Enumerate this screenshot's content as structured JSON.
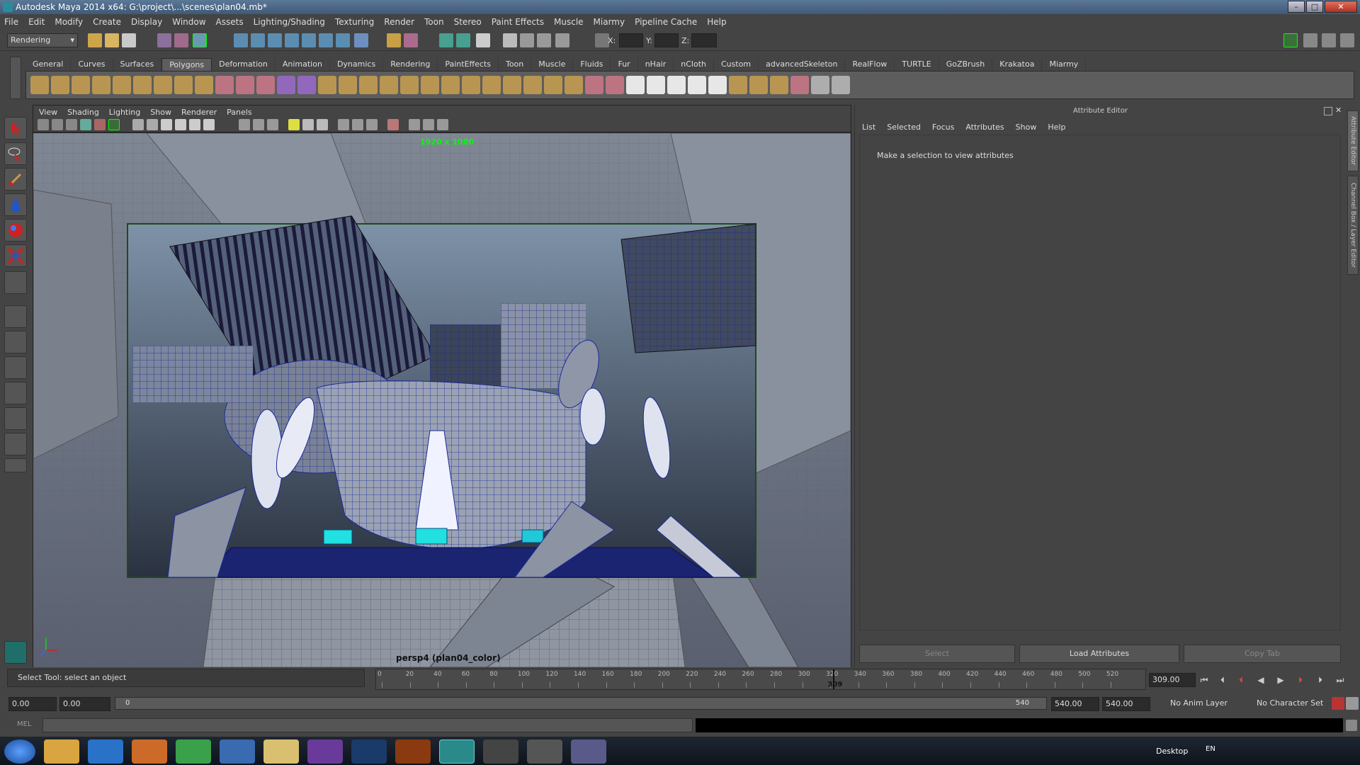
{
  "window": {
    "title": "Autodesk Maya 2014 x64: G:\\project\\...\\scenes\\plan04.mb*"
  },
  "menubar": [
    "File",
    "Edit",
    "Modify",
    "Create",
    "Display",
    "Window",
    "Assets",
    "Lighting/Shading",
    "Texturing",
    "Render",
    "Toon",
    "Stereo",
    "Paint Effects",
    "Muscle",
    "Miarmy",
    "Pipeline Cache",
    "Help"
  ],
  "statusline": {
    "menuset": "Rendering",
    "x_label": "X:",
    "y_label": "Y:",
    "z_label": "Z:"
  },
  "shelf_tabs": [
    "General",
    "Curves",
    "Surfaces",
    "Polygons",
    "Deformation",
    "Animation",
    "Dynamics",
    "Rendering",
    "PaintEffects",
    "Toon",
    "Muscle",
    "Fluids",
    "Fur",
    "nHair",
    "nCloth",
    "Custom",
    "advancedSkeleton",
    "RealFlow",
    "TURTLE",
    "GoZBrush",
    "Krakatoa",
    "Miarmy"
  ],
  "active_shelf": "Polygons",
  "viewport": {
    "menu": [
      "View",
      "Shading",
      "Lighting",
      "Show",
      "Renderer",
      "Panels"
    ],
    "resolution_label": "1920 x 1080",
    "camera_label": "persp4 (plan04_color)"
  },
  "attribute_editor": {
    "title": "Attribute Editor",
    "menu": [
      "List",
      "Selected",
      "Focus",
      "Attributes",
      "Show",
      "Help"
    ],
    "message": "Make a selection to view attributes",
    "buttons": {
      "select": "Select",
      "load": "Load Attributes",
      "copy": "Copy Tab"
    }
  },
  "side_tabs": {
    "attribute_editor": "Attribute Editor",
    "channel_box": "Channel Box / Layer Editor"
  },
  "helpline": "Select Tool: select an object",
  "timeslider": {
    "ticks": [
      "0",
      "20",
      "40",
      "60",
      "80",
      "100",
      "120",
      "140",
      "160",
      "180",
      "200",
      "220",
      "240",
      "260",
      "280",
      "300",
      "320",
      "340",
      "360",
      "380",
      "400",
      "420",
      "440",
      "460",
      "480",
      "500",
      "520"
    ],
    "current_frame": "309",
    "current_field": "309.00",
    "fraction": 0.5935
  },
  "range": {
    "start_field": "0.00",
    "start2_field": "0.00",
    "slider_start": "0",
    "slider_end": "540",
    "end_field": "540.00",
    "end2_field": "540.00",
    "anim_layer": "No Anim Layer",
    "character_set": "No Character Set"
  },
  "cmdline": {
    "label": "MEL"
  },
  "taskbar": {
    "desktop": "Desktop",
    "lang": "EN"
  },
  "colors": {
    "accent_green": "#00ff00",
    "wire_blue": "#1a2a9a",
    "highlight_cyan": "#20e0e0"
  }
}
